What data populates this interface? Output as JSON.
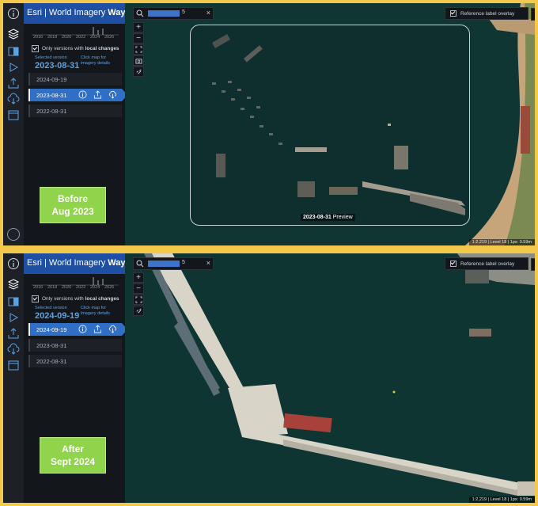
{
  "header": {
    "brand": "Esri | World Imagery",
    "brand_bold": "Wayback"
  },
  "timeline_years": [
    "2016",
    "2018",
    "2020",
    "2022",
    "2024",
    "2026"
  ],
  "filter": {
    "label_prefix": "Only versions with",
    "label_bold": "local changes"
  },
  "selected_label": "Selected version",
  "click_map": "Click map for imagery details",
  "panels": [
    {
      "selected_date": "2023-08-31",
      "versions": [
        {
          "date": "2024-09-19",
          "active": false
        },
        {
          "date": "2023-08-31",
          "active": true
        },
        {
          "date": "2022-08-31",
          "active": false
        }
      ],
      "callout": [
        "Before",
        "Aug 2023"
      ],
      "preview": {
        "date": "2023-08-31",
        "label": "Preview"
      }
    },
    {
      "selected_date": "2024-09-19",
      "versions": [
        {
          "date": "2024-09-19",
          "active": true
        },
        {
          "date": "2023-08-31",
          "active": false
        },
        {
          "date": "2022-08-31",
          "active": false
        }
      ],
      "callout": [
        "After",
        "Sept 2024"
      ]
    }
  ],
  "search": {
    "value_suffix": "5",
    "clear": "×"
  },
  "zoom": {
    "in": "+",
    "out": "−"
  },
  "reference_overlay": "Reference label overlay",
  "scale_info": "1:2,219 | Level 18 | 1px: 0.59m",
  "colors": {
    "accent": "#2f6fc6",
    "callout": "#8fd44a",
    "frame": "#f2c94c",
    "water": "#0f3533",
    "sand": "#c7a57a"
  }
}
